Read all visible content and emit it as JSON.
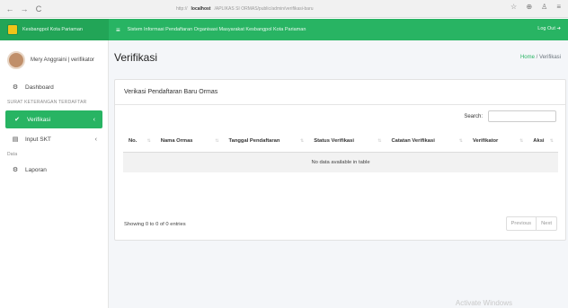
{
  "browser": {
    "back_icon": "←",
    "forward_icon": "→",
    "reload_icon": "C",
    "url_host": "localhost",
    "url_path": "/APLIKAS SI ORMAS/public/admin/verifikasi-baru",
    "url_prefix": "http://"
  },
  "header": {
    "brand": "Kesbangpol Kota Pariaman",
    "menu_icon": "≡",
    "title": "Sistem Informasi Pendaftaran Organisasi Masyarakat Kesbangpol Kota Pariaman",
    "logout": "Log Out ➜"
  },
  "sidebar": {
    "user": "Mery Anggraini | verifikator",
    "dashboard": "Dashboard",
    "section_skt": "SURAT KETERANGAN TERDAFTAR",
    "verifikasi": "Verifikasi",
    "input_skt": "Input SKT",
    "section_data": "Data",
    "laporan": "Laporan",
    "chevron": "‹"
  },
  "main": {
    "page_title": "Verifikasi",
    "breadcrumb_home": "Home",
    "breadcrumb_sep": " / ",
    "breadcrumb_current": "Verifikasi",
    "card_title": "Verikasi Pendaftaran Baru Ormas",
    "search_label": "Search:",
    "columns": [
      "No.",
      "Nama Ormas",
      "Tanggal Pendaftaran",
      "Status Verifikasi",
      "Catatan Verifikasi",
      "Verifikator",
      "Aksi"
    ],
    "empty_text": "No data available in table",
    "info_text": "Showing 0 to 0 of 0 entries",
    "prev": "Previous",
    "next": "Next"
  },
  "watermark": "Activate Windows",
  "colors": {
    "accent": "#28b463"
  }
}
